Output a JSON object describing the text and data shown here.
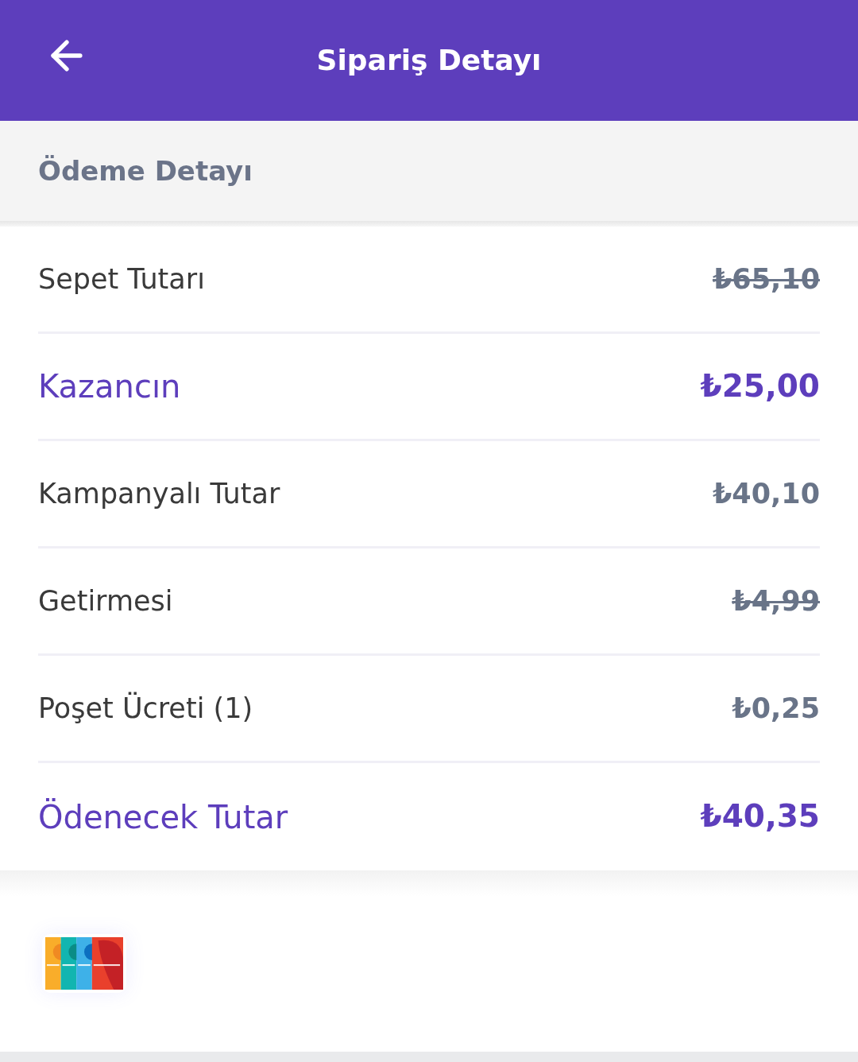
{
  "header": {
    "title": "Sipariş Detayı"
  },
  "section": {
    "title": "Ödeme Detayı"
  },
  "rows": [
    {
      "kind": "regular",
      "label": "Sepet Tutarı",
      "value": "₺65,10",
      "struck_through": true
    },
    {
      "kind": "highlight",
      "label": "Kazancın",
      "value": "₺25,00",
      "struck_through": false
    },
    {
      "kind": "regular",
      "label": "Kampanyalı Tutar",
      "value": "₺40,10",
      "struck_through": false
    },
    {
      "kind": "regular",
      "label": "Getirmesi",
      "value": "₺4,99",
      "struck_through": true
    },
    {
      "kind": "regular",
      "label": "Poşet Ücreti (1)",
      "value": "₺0,25",
      "struck_through": false
    },
    {
      "kind": "highlight",
      "label": "Ödenecek Tutar",
      "value": "₺40,35",
      "struck_through": false
    }
  ]
}
